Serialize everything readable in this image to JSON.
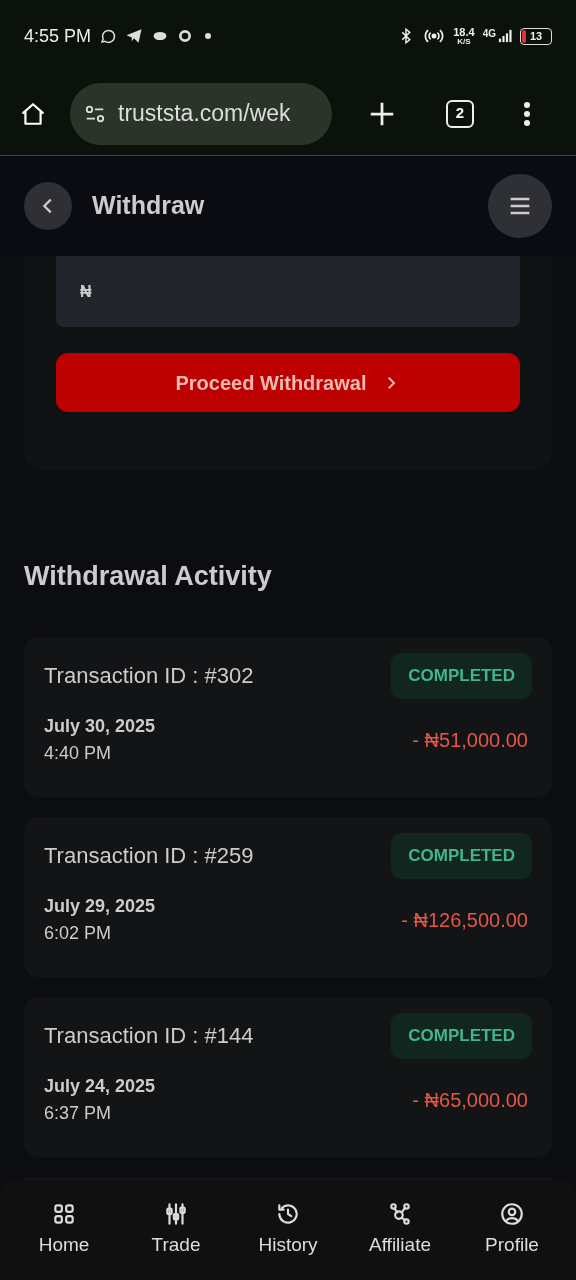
{
  "status_bar": {
    "time": "4:55 PM",
    "speed": "18.4",
    "speed_unit": "K/S",
    "network": "4G",
    "battery": "13"
  },
  "browser": {
    "url": "truststa.com/wek",
    "tab_count": "2"
  },
  "header": {
    "title": "Withdraw"
  },
  "amount_field": {
    "currency": "₦"
  },
  "proceed_button": {
    "label": "Proceed Withdrawal"
  },
  "activity": {
    "heading": "Withdrawal Activity",
    "transactions": [
      {
        "id": "Transaction ID : #302",
        "status": "COMPLETED",
        "date": "July 30, 2025",
        "time": "4:40 PM",
        "amount": "- ₦51,000.00"
      },
      {
        "id": "Transaction ID : #259",
        "status": "COMPLETED",
        "date": "July 29, 2025",
        "time": "6:02 PM",
        "amount": "- ₦126,500.00"
      },
      {
        "id": "Transaction ID : #144",
        "status": "COMPLETED",
        "date": "July 24, 2025",
        "time": "6:37 PM",
        "amount": "- ₦65,000.00"
      }
    ]
  },
  "bottom_nav": [
    {
      "kind": "home",
      "label": "Home"
    },
    {
      "kind": "trade",
      "label": "Trade"
    },
    {
      "kind": "history",
      "label": "History"
    },
    {
      "kind": "affiliate",
      "label": "Affiliate"
    },
    {
      "kind": "profile",
      "label": "Profile"
    }
  ]
}
